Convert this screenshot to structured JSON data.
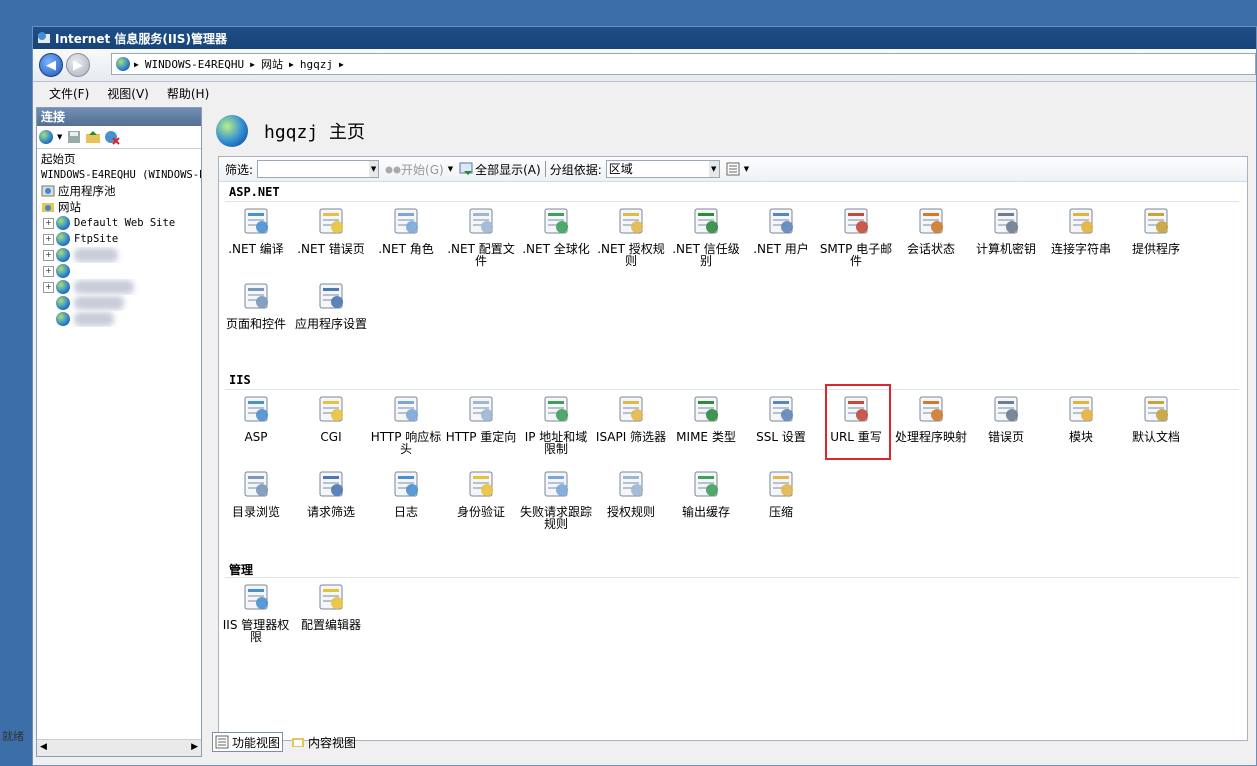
{
  "window": {
    "title": "Internet 信息服务(IIS)管理器"
  },
  "address": {
    "crumbs": [
      "WINDOWS-E4REQHU",
      "网站",
      "hgqzj"
    ]
  },
  "menu": [
    "文件(F)",
    "视图(V)",
    "帮助(H)"
  ],
  "connections": {
    "header": "连接",
    "tree": {
      "start": "起始页",
      "server": "WINDOWS-E4REQHU (WINDOWS-E",
      "apppools": "应用程序池",
      "sites": "网站",
      "site1": "Default Web Site",
      "site2": "FtpSite"
    }
  },
  "page": {
    "title": "hgqzj 主页"
  },
  "filter": {
    "label": "筛选:",
    "start": "开始(G)",
    "showall": "全部显示(A)",
    "groupby": "分组依据:",
    "group_value": "区域"
  },
  "sections": {
    "aspnet": "ASP.NET",
    "iis": "IIS",
    "mgmt": "管理"
  },
  "aspnet_features": [
    {
      "label": ".NET 编译"
    },
    {
      "label": ".NET 错误页"
    },
    {
      "label": ".NET 角色"
    },
    {
      "label": ".NET 配置文件"
    },
    {
      "label": ".NET 全球化"
    },
    {
      "label": ".NET 授权规则"
    },
    {
      "label": ".NET 信任级别"
    },
    {
      "label": ".NET 用户"
    },
    {
      "label": "SMTP 电子邮件"
    },
    {
      "label": "会话状态"
    },
    {
      "label": "计算机密钥"
    },
    {
      "label": "连接字符串"
    },
    {
      "label": "提供程序"
    },
    {
      "label": "页面和控件"
    },
    {
      "label": "应用程序设置"
    }
  ],
  "iis_features": [
    {
      "label": "ASP"
    },
    {
      "label": "CGI"
    },
    {
      "label": "HTTP 响应标头"
    },
    {
      "label": "HTTP 重定向"
    },
    {
      "label": "IP 地址和域限制"
    },
    {
      "label": "ISAPI 筛选器"
    },
    {
      "label": "MIME 类型"
    },
    {
      "label": "SSL 设置"
    },
    {
      "label": "URL 重写"
    },
    {
      "label": "处理程序映射"
    },
    {
      "label": "错误页"
    },
    {
      "label": "模块"
    },
    {
      "label": "默认文档"
    },
    {
      "label": "目录浏览"
    },
    {
      "label": "请求筛选"
    },
    {
      "label": "日志"
    },
    {
      "label": "身份验证"
    },
    {
      "label": "失败请求跟踪规则"
    },
    {
      "label": "授权规则"
    },
    {
      "label": "输出缓存"
    },
    {
      "label": "压缩"
    }
  ],
  "mgmt_features": [
    {
      "label": "IIS 管理器权限"
    },
    {
      "label": "配置编辑器"
    }
  ],
  "bottom_tabs": {
    "features": "功能视图",
    "content": "内容视图"
  },
  "status": "就绪",
  "colors": {
    "highlight": "#e0262a",
    "titlebar": "#1e4f86",
    "desktop": "#3c6ea8"
  }
}
